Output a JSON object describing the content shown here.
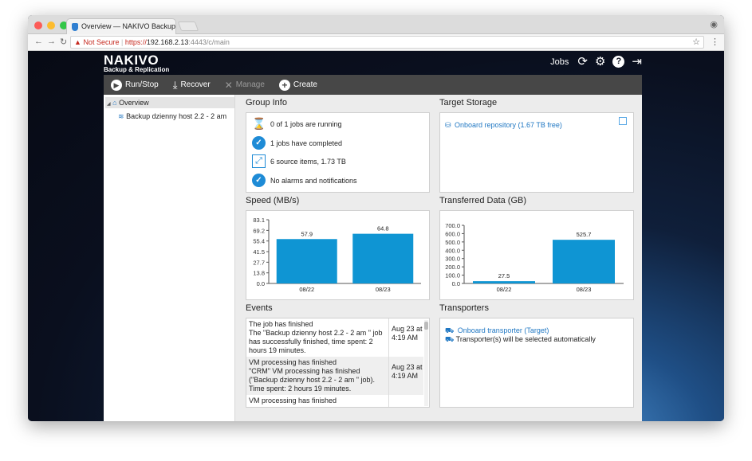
{
  "browser": {
    "tab_title": "Overview — NAKIVO Backup & ×",
    "not_secure": "Not Secure",
    "url_scheme": "https://",
    "url_host": "192.168.2.13",
    "url_rest": ":4443/c/main"
  },
  "app": {
    "logo_main": "NAKIVO",
    "logo_sub": "Backup & Replication",
    "nav_jobs": "Jobs"
  },
  "toolbar": {
    "run_stop": "Run/Stop",
    "recover": "Recover",
    "manage": "Manage",
    "create": "Create"
  },
  "tree": {
    "root": "Overview",
    "child": "Backup dzienny host 2.2 - 2 am"
  },
  "group_info": {
    "title": "Group Info",
    "running": "0 of 1 jobs are running",
    "completed": "1 jobs have completed",
    "source": "6 source items, 1.73 TB",
    "alarms": "No alarms and notifications"
  },
  "target_storage": {
    "title": "Target Storage",
    "repo": "Onboard repository (1.67 TB free)"
  },
  "speed": {
    "title": "Speed (MB/s)"
  },
  "transferred": {
    "title": "Transferred Data (GB)"
  },
  "events": {
    "title": "Events",
    "items": [
      {
        "heading": "The job has finished",
        "body": "The \"Backup dzienny host 2.2 - 2 am \" job has successfully finished, time spent: 2 hours 19 minutes.",
        "date": "Aug 23 at 4:19 AM"
      },
      {
        "heading": "VM processing has finished",
        "body": "\"CRM\" VM processing has finished (\"Backup dzienny host 2.2 - 2 am \" job). Time spent: 2 hours 19 minutes.",
        "date": "Aug 23 at 4:19 AM"
      },
      {
        "heading": "VM processing has finished",
        "body": "",
        "date": ""
      }
    ]
  },
  "transporters": {
    "title": "Transporters",
    "onboard": "Onboard transporter (Target)",
    "auto": "Transporter(s) will be selected automatically"
  },
  "chart_data": [
    {
      "type": "bar",
      "categories": [
        "08/22",
        "08/23"
      ],
      "values": [
        57.9,
        64.8
      ],
      "yticks": [
        0.0,
        13.8,
        27.7,
        41.5,
        55.4,
        69.2,
        83.1
      ],
      "ylim": [
        0,
        83.1
      ],
      "color": "#0f95d3"
    },
    {
      "type": "bar",
      "categories": [
        "08/22",
        "08/23"
      ],
      "values": [
        27.5,
        525.7
      ],
      "yticks": [
        0.0,
        100.0,
        200.0,
        300.0,
        400.0,
        500.0,
        600.0,
        700.0
      ],
      "ylim": [
        0,
        700
      ],
      "color": "#0f95d3"
    }
  ]
}
